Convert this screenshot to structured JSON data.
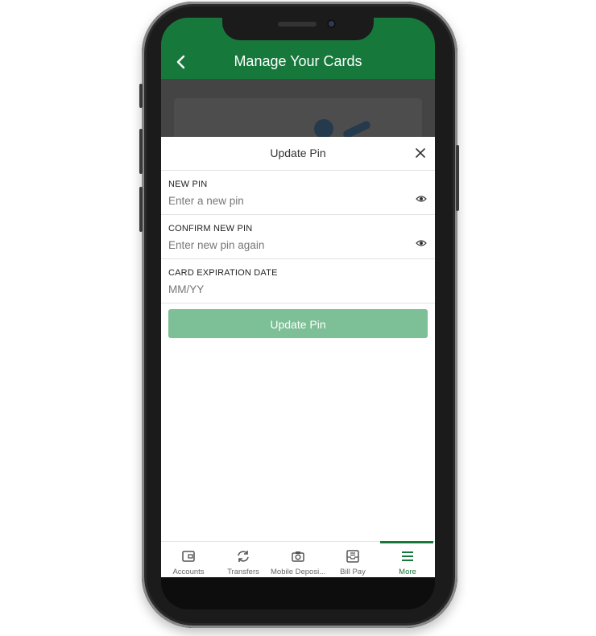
{
  "header": {
    "title": "Manage Your Cards",
    "back_icon": "chevron-left-icon"
  },
  "sheet": {
    "title": "Update Pin",
    "close_icon": "close-icon",
    "fields": [
      {
        "label": "NEW PIN",
        "placeholder": "Enter a new pin",
        "has_eye_icon": true
      },
      {
        "label": "CONFIRM NEW PIN",
        "placeholder": "Enter new pin again",
        "has_eye_icon": true
      },
      {
        "label": "CARD EXPIRATION DATE",
        "placeholder": "MM/YY",
        "has_eye_icon": false
      }
    ],
    "submit_label": "Update Pin"
  },
  "tabbar": {
    "tabs": [
      {
        "label": "Accounts",
        "icon": "wallet-icon"
      },
      {
        "label": "Transfers",
        "icon": "refresh-icon"
      },
      {
        "label": "Mobile Deposi...",
        "icon": "camera-icon"
      },
      {
        "label": "Bill Pay",
        "icon": "inbox-icon"
      },
      {
        "label": "More",
        "icon": "menu-icon",
        "active": true
      }
    ]
  },
  "colors": {
    "brand": "#17783c",
    "button_disabled": "#7dbf96"
  }
}
